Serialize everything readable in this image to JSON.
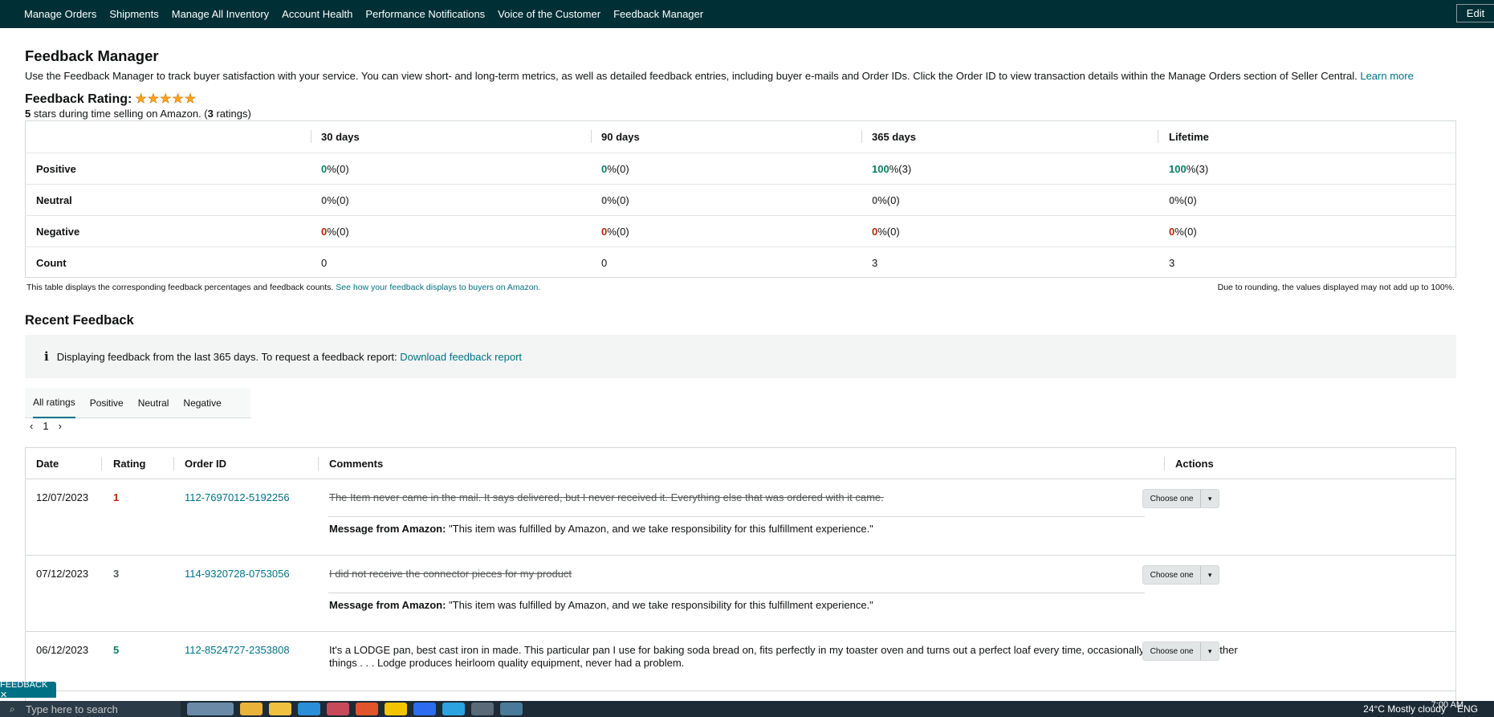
{
  "nav": {
    "items": [
      "Manage Orders",
      "Shipments",
      "Manage All Inventory",
      "Account Health",
      "Performance Notifications",
      "Voice of the Customer",
      "Feedback Manager"
    ],
    "edit_label": "Edit"
  },
  "page": {
    "title": "Feedback Manager",
    "intro": "Use the Feedback Manager to track buyer satisfaction with your service. You can view short- and long-term metrics, as well as detailed feedback entries, including buyer e-mails and Order IDs. Click the Order ID to view transaction details within the Manage Orders section of Seller Central.",
    "learn_more": "Learn more",
    "rating_label": "Feedback Rating:",
    "rating_stars": 5,
    "rating_sub_stars": "5",
    "rating_sub_text": " stars during time selling on Amazon. (",
    "rating_sub_count": "3",
    "rating_sub_end": " ratings)"
  },
  "metrics": {
    "columns": [
      "30 days",
      "90 days",
      "365 days",
      "Lifetime"
    ],
    "rows": [
      {
        "label": "Positive",
        "values": [
          {
            "num": "0",
            "rest": " %(0)"
          },
          {
            "num": "0",
            "rest": " %(0)"
          },
          {
            "num": "100",
            "rest": " %(3)"
          },
          {
            "num": "100",
            "rest": " %(3)"
          }
        ]
      },
      {
        "label": "Neutral",
        "values": [
          {
            "num": "0",
            "rest": " %(0)"
          },
          {
            "num": "0",
            "rest": " %(0)"
          },
          {
            "num": "0",
            "rest": " %(0)"
          },
          {
            "num": "0",
            "rest": " %(0)"
          }
        ]
      },
      {
        "label": "Negative",
        "values": [
          {
            "num": "0",
            "rest": " %(0)"
          },
          {
            "num": "0",
            "rest": " %(0)"
          },
          {
            "num": "0",
            "rest": " %(0)"
          },
          {
            "num": "0",
            "rest": " %(0)"
          }
        ]
      },
      {
        "label": "Count",
        "values": [
          {
            "num": "",
            "rest": "0"
          },
          {
            "num": "",
            "rest": "0"
          },
          {
            "num": "",
            "rest": "3"
          },
          {
            "num": "",
            "rest": "3"
          }
        ]
      }
    ],
    "note_left": "This table displays the corresponding feedback percentages and feedback counts.",
    "note_link": "See how your feedback displays to buyers on Amazon.",
    "note_right": "Due to rounding, the values displayed may not add up to 100%."
  },
  "recent": {
    "title": "Recent Feedback",
    "info_icon": "i",
    "info_text": "Displaying feedback from the last 365 days. To request a feedback report:",
    "info_link": "Download feedback report",
    "tabs": [
      "All ratings",
      "Positive",
      "Neutral",
      "Negative"
    ],
    "page_number": "1",
    "prev": "‹",
    "next": "›",
    "headers": [
      "Date",
      "Rating",
      "Order ID",
      "Comments",
      "Actions"
    ],
    "rows": [
      {
        "date": "12/07/2023",
        "rating": "1",
        "order_id": "112-7697012-5192256",
        "comment": "The Item never came in the mail. It says delivered, but I never received it. Everything else that was ordered with it came.",
        "struck": true,
        "amazon_label": "Message from Amazon:",
        "amazon_msg": " \"This item was fulfilled by Amazon, and we take responsibility for this fulfillment experience.\"",
        "action": "Choose one"
      },
      {
        "date": "07/12/2023",
        "rating": "3",
        "order_id": "114-9320728-0753056",
        "comment": "I did not receive the connector pieces for my product",
        "struck": true,
        "amazon_label": "Message from Amazon:",
        "amazon_msg": " \"This item was fulfilled by Amazon, and we take responsibility for this fulfillment experience.\"",
        "action": "Choose one"
      },
      {
        "date": "06/12/2023",
        "rating": "5",
        "order_id": "112-8524727-2353808",
        "comment_line1": "It's a LODGE pan, best cast iron in made. This particular pan I use for baking soda bread on, fits perfectly in my toaster oven and turns out a perfect loaf every time, occasionally I use them for other",
        "comment_line2": "things . . . Lodge produces heirloom quality equipment, never had a problem.",
        "struck": false,
        "action": "Choose one"
      }
    ]
  },
  "feedback_tab": "FEEDBACK ✕",
  "taskbar": {
    "search_placeholder": "Type here to search",
    "weather": "24°C  Mostly cloudy",
    "lang": "ENG",
    "time": "7:00 AM"
  },
  "colors": {
    "nav_bg": "#002f36",
    "link": "#007185",
    "positive": "#067d62",
    "negative": "#b12704",
    "star": "#ffa41c"
  }
}
